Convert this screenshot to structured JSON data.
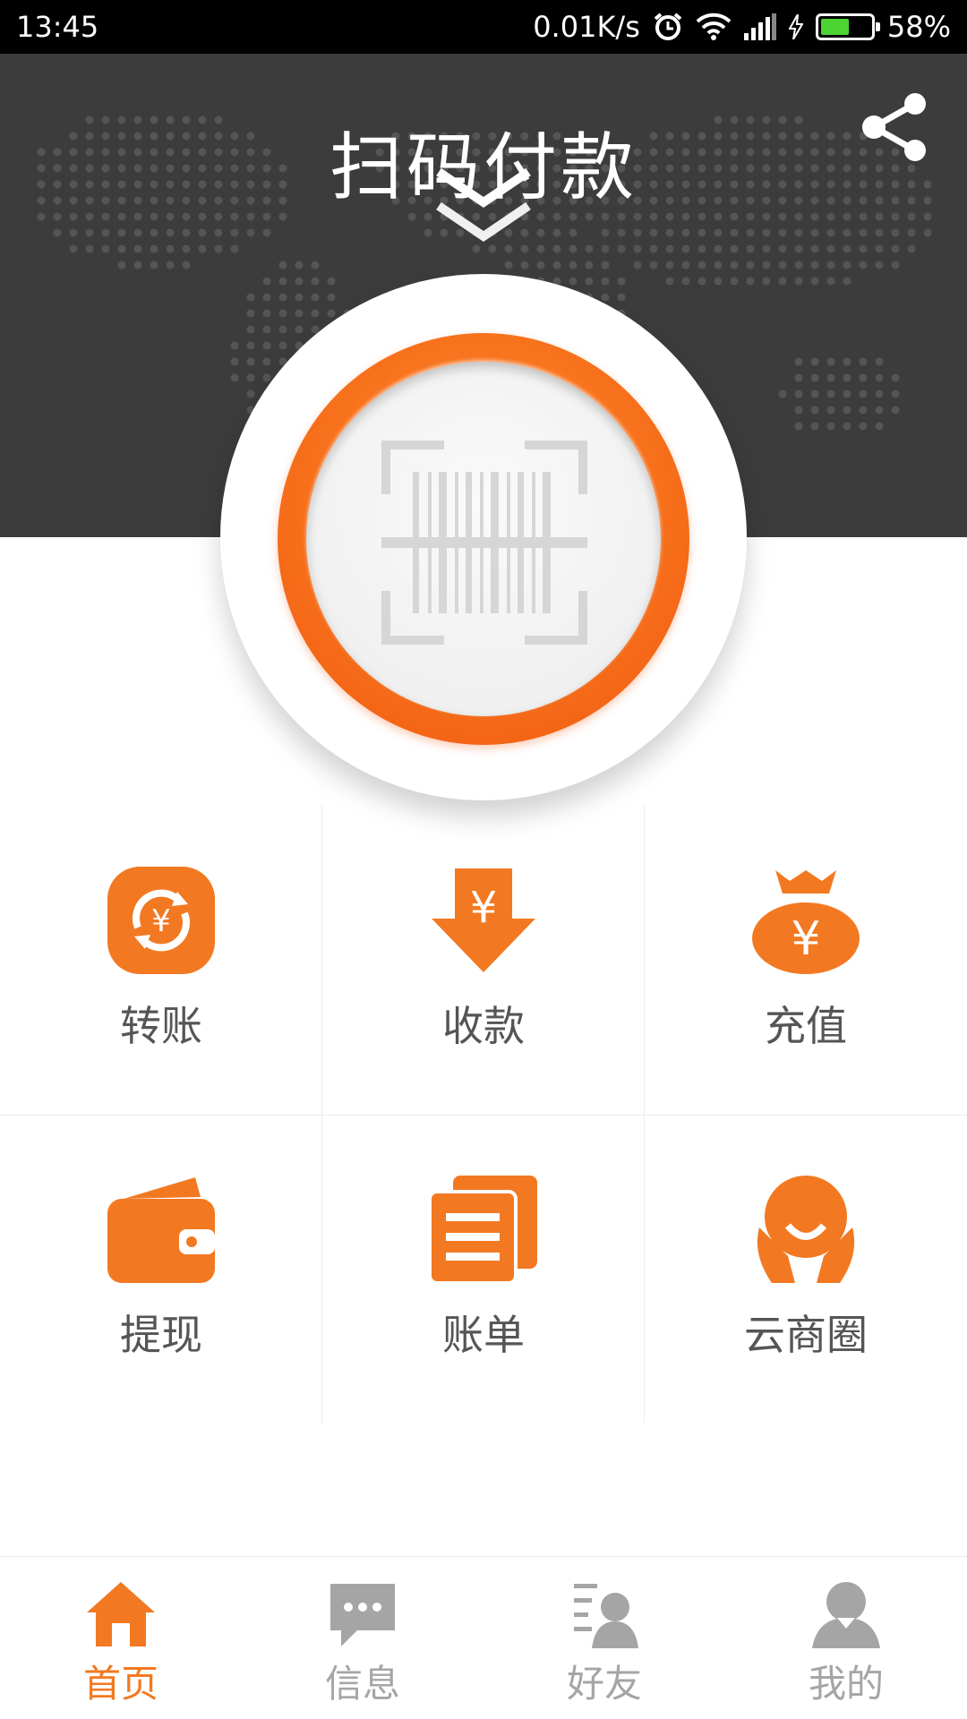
{
  "status_bar": {
    "time": "13:45",
    "net_speed": "0.01K/s",
    "battery": "58%",
    "battery_level": 0.58
  },
  "header": {
    "title": "扫码付款",
    "share_icon": "share-icon",
    "chevron_icon": "double-chevron-down-icon"
  },
  "scan_button": {
    "icon": "barcode-scan-icon"
  },
  "colors": {
    "accent": "#f27922",
    "hero_bg": "#3c3c3c",
    "inactive": "#a5a5a5"
  },
  "actions": [
    {
      "label": "转账",
      "icon": "transfer-yen-icon"
    },
    {
      "label": "收款",
      "icon": "receive-arrow-icon"
    },
    {
      "label": "充值",
      "icon": "money-bag-icon"
    },
    {
      "label": "提现",
      "icon": "wallet-icon"
    },
    {
      "label": "账单",
      "icon": "bill-icon"
    },
    {
      "label": "云商圈",
      "icon": "smile-person-icon"
    }
  ],
  "tabs": [
    {
      "label": "首页",
      "icon": "home-icon",
      "active": true
    },
    {
      "label": "信息",
      "icon": "message-icon",
      "active": false
    },
    {
      "label": "好友",
      "icon": "friends-icon",
      "active": false
    },
    {
      "label": "我的",
      "icon": "profile-icon",
      "active": false
    }
  ]
}
